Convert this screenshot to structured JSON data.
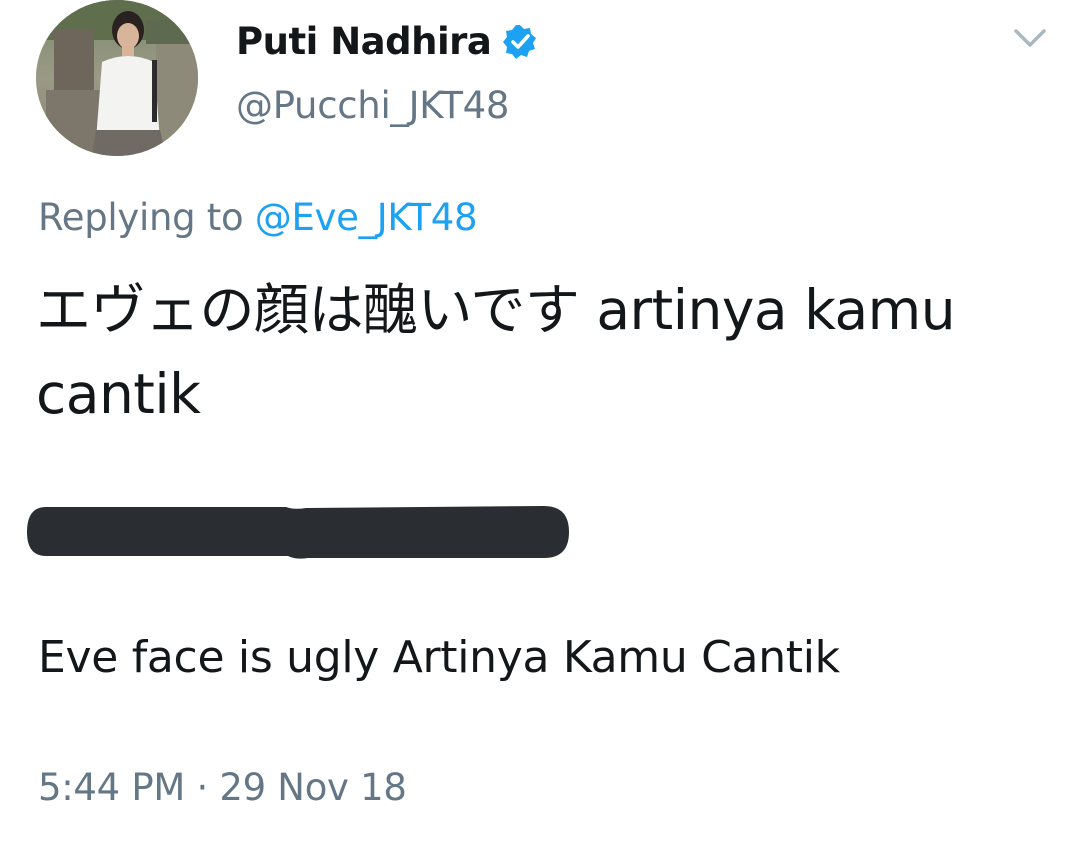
{
  "tweet": {
    "author": {
      "display_name": "Puti Nadhira",
      "handle": "@Pucchi_JKT48",
      "verified_icon": "verified-badge-icon",
      "avatar": "profile-photo"
    },
    "menu_icon": "chevron-down-icon",
    "reply_prefix": "Replying to ",
    "reply_mention": "@Eve_JKT48",
    "text": "エヴェの顔は醜いです artinya kamu cantik",
    "translation": "Eve face is ugly Artinya Kamu Cantik",
    "timestamp": "5:44 PM · 29 Nov 18"
  },
  "colors": {
    "text_primary": "#14171a",
    "text_secondary": "#657786",
    "link": "#1da1f2",
    "verified": "#1da1f2",
    "redaction": "#2a2e33"
  }
}
